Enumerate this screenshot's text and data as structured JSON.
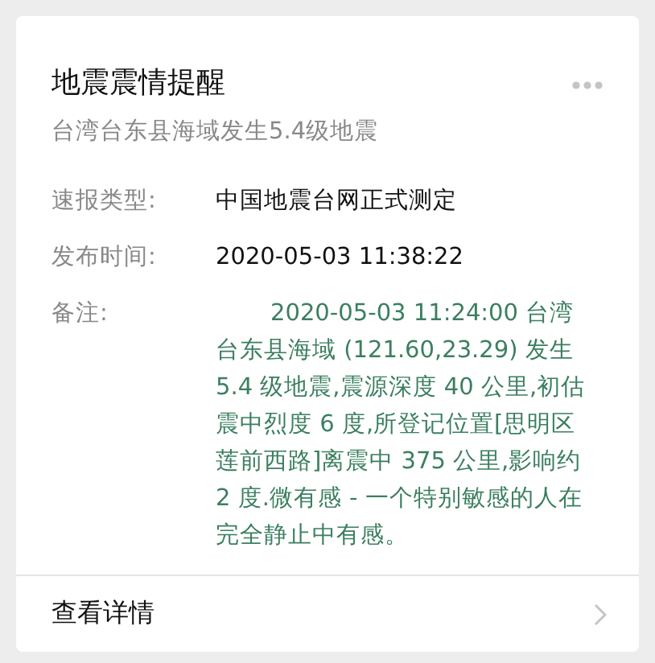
{
  "card": {
    "title": "地震震情提醒",
    "subtitle": "台湾台东县海域发生5.4级地震",
    "fields": [
      {
        "label": "速报类型:",
        "value": "中国地震台网正式测定",
        "kind": "plain"
      },
      {
        "label": "发布时间:",
        "value": "2020-05-03 11:38:22",
        "kind": "plain"
      },
      {
        "label": "备注:",
        "value": "2020-05-03 11:24:00 台湾台东县海域 (121.60,23.29) 发生 5.4 级地震,震源深度 40 公里,初估震中烈度 6 度,所登记位置[思明区莲前西路]离震中 375 公里,影响约 2 度.微有感 - 一个特别敏感的人在完全静止中有感。",
        "kind": "note"
      }
    ],
    "footer": {
      "label": "查看详情"
    }
  }
}
